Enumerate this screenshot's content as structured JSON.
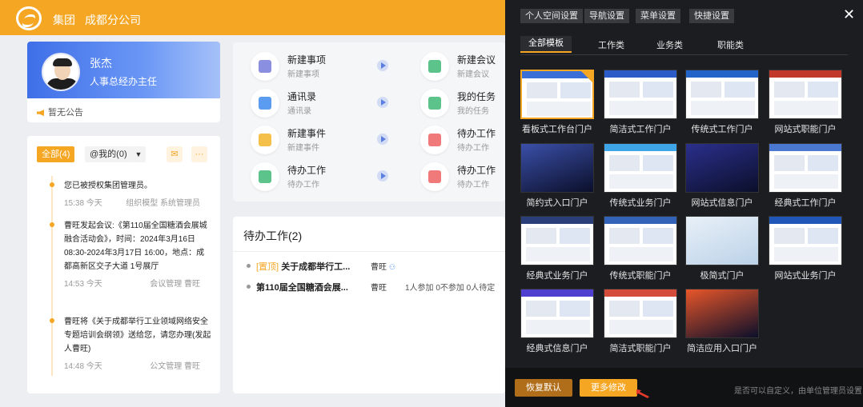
{
  "header": {
    "org_name": "集团",
    "branch": "成都分公司"
  },
  "profile": {
    "name": "张杰",
    "title": "人事总经办主任",
    "notice": "暂无公告"
  },
  "messages": {
    "tab_all": "全部(4)",
    "tab_mine": "@我的(0)",
    "items": [
      {
        "text": "您已被授权集团管理员。",
        "time": "15:38 今天",
        "source": "组织模型 系统管理员"
      },
      {
        "text": "曹旺发起会议:《第110届全国糖酒会展城融合活动会》，时间：2024年3月16日 08:30-2024年3月17日 16:00，地点：成都高新区交子大道 1号展厅",
        "time": "14:53 今天",
        "source": "会议管理 曹旺"
      },
      {
        "text": "曹旺将《关于成都举行工业领域网络安全专题培训会纲领》送给您，请您办理(发起人曹旺)",
        "time": "14:48 今天",
        "source": "公文管理 曹旺"
      }
    ]
  },
  "quick": [
    {
      "title": "新建事项",
      "sub": "新建事项",
      "color": "purple"
    },
    {
      "title": "新建会议",
      "sub": "新建会议",
      "color": "green"
    },
    {
      "title": "通讯录",
      "sub": "通讯录",
      "color": "blue"
    },
    {
      "title": "我的任务",
      "sub": "我的任务",
      "color": "green"
    },
    {
      "title": "新建事件",
      "sub": "新建事件",
      "color": "yellow"
    },
    {
      "title": "待办工作",
      "sub": "待办工作",
      "color": "red"
    },
    {
      "title": "待办工作",
      "sub": "待办工作",
      "color": "green"
    },
    {
      "title": "待办工作",
      "sub": "待办工作",
      "color": "red"
    }
  ],
  "todo": {
    "title": "待办工作(2)",
    "rows": [
      {
        "tag": "[置顶]",
        "title": "关于成都举行工...",
        "who": "曹旺",
        "status": ""
      },
      {
        "tag": "",
        "title": "第110届全国糖酒会展...",
        "who": "曹旺",
        "status": "1人参加 0不参加 0人待定"
      }
    ]
  },
  "panel": {
    "top_tabs": [
      "个人空间设置",
      "导航设置",
      "菜单设置",
      "快捷设置"
    ],
    "sub_tabs": [
      "全部模板",
      "工作类",
      "业务类",
      "职能类"
    ],
    "templates": [
      {
        "name": "看板式工作台门户",
        "theme": "#3b6fd8",
        "selected": true
      },
      {
        "name": "简洁式工作门户",
        "theme": "#2a5bc7"
      },
      {
        "name": "传统式工作门户",
        "theme": "#2364c9"
      },
      {
        "name": "网站式职能门户",
        "theme": "#c0392b"
      },
      {
        "name": "简约式入口门户",
        "theme": "#3a4fa8"
      },
      {
        "name": "传统式业务门户",
        "theme": "#3ea6e8"
      },
      {
        "name": "网站式信息门户",
        "theme": "#2b2f8c"
      },
      {
        "name": "经典式工作门户",
        "theme": "#4a78d0"
      },
      {
        "name": "经典式业务门户",
        "theme": "#2a3f7a"
      },
      {
        "name": "传统式职能门户",
        "theme": "#3263b8"
      },
      {
        "name": "极简式门户",
        "theme": "#d8e6f4"
      },
      {
        "name": "网站式业务门户",
        "theme": "#1f56b8"
      },
      {
        "name": "经典式信息门户",
        "theme": "#4f3fd0"
      },
      {
        "name": "简洁式职能门户",
        "theme": "#d44b3a"
      },
      {
        "name": "简洁应用入口门户",
        "theme": "#e8562a"
      }
    ],
    "reset_label": "恢复默认",
    "more_label": "更多修改",
    "hint": "是否可以自定义，由单位管理员设置"
  }
}
